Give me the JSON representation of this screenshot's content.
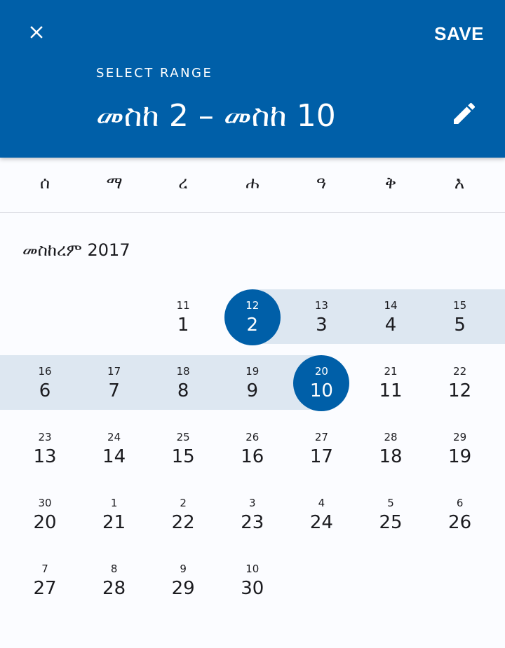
{
  "header": {
    "save_label": "SAVE",
    "select_range_label": "SELECT RANGE",
    "range_text": "መስከ 2 – መስከ 10",
    "close_icon": "close-icon",
    "edit_icon": "pencil-icon",
    "background_color": "#005fa8"
  },
  "weekdays": [
    "ሰ",
    "ማ",
    "ረ",
    "ሐ",
    "ዓ",
    "ቅ",
    "እ"
  ],
  "calendar": {
    "month_title": "መስከረም 2017",
    "selected_start": "2",
    "selected_end": "10",
    "range_color": "#dde7f1",
    "weeks": [
      [
        null,
        null,
        {
          "g": "11",
          "d": "1"
        },
        {
          "g": "12",
          "d": "2"
        },
        {
          "g": "13",
          "d": "3"
        },
        {
          "g": "14",
          "d": "4"
        },
        {
          "g": "15",
          "d": "5"
        }
      ],
      [
        {
          "g": "16",
          "d": "6"
        },
        {
          "g": "17",
          "d": "7"
        },
        {
          "g": "18",
          "d": "8"
        },
        {
          "g": "19",
          "d": "9"
        },
        {
          "g": "20",
          "d": "10"
        },
        {
          "g": "21",
          "d": "11"
        },
        {
          "g": "22",
          "d": "12"
        }
      ],
      [
        {
          "g": "23",
          "d": "13"
        },
        {
          "g": "24",
          "d": "14"
        },
        {
          "g": "25",
          "d": "15"
        },
        {
          "g": "26",
          "d": "16"
        },
        {
          "g": "27",
          "d": "17"
        },
        {
          "g": "28",
          "d": "18"
        },
        {
          "g": "29",
          "d": "19"
        }
      ],
      [
        {
          "g": "30",
          "d": "20"
        },
        {
          "g": "1",
          "d": "21"
        },
        {
          "g": "2",
          "d": "22"
        },
        {
          "g": "3",
          "d": "23"
        },
        {
          "g": "4",
          "d": "24"
        },
        {
          "g": "5",
          "d": "25"
        },
        {
          "g": "6",
          "d": "26"
        }
      ],
      [
        {
          "g": "7",
          "d": "27"
        },
        {
          "g": "8",
          "d": "28"
        },
        {
          "g": "9",
          "d": "29"
        },
        {
          "g": "10",
          "d": "30"
        },
        null,
        null,
        null
      ]
    ]
  }
}
